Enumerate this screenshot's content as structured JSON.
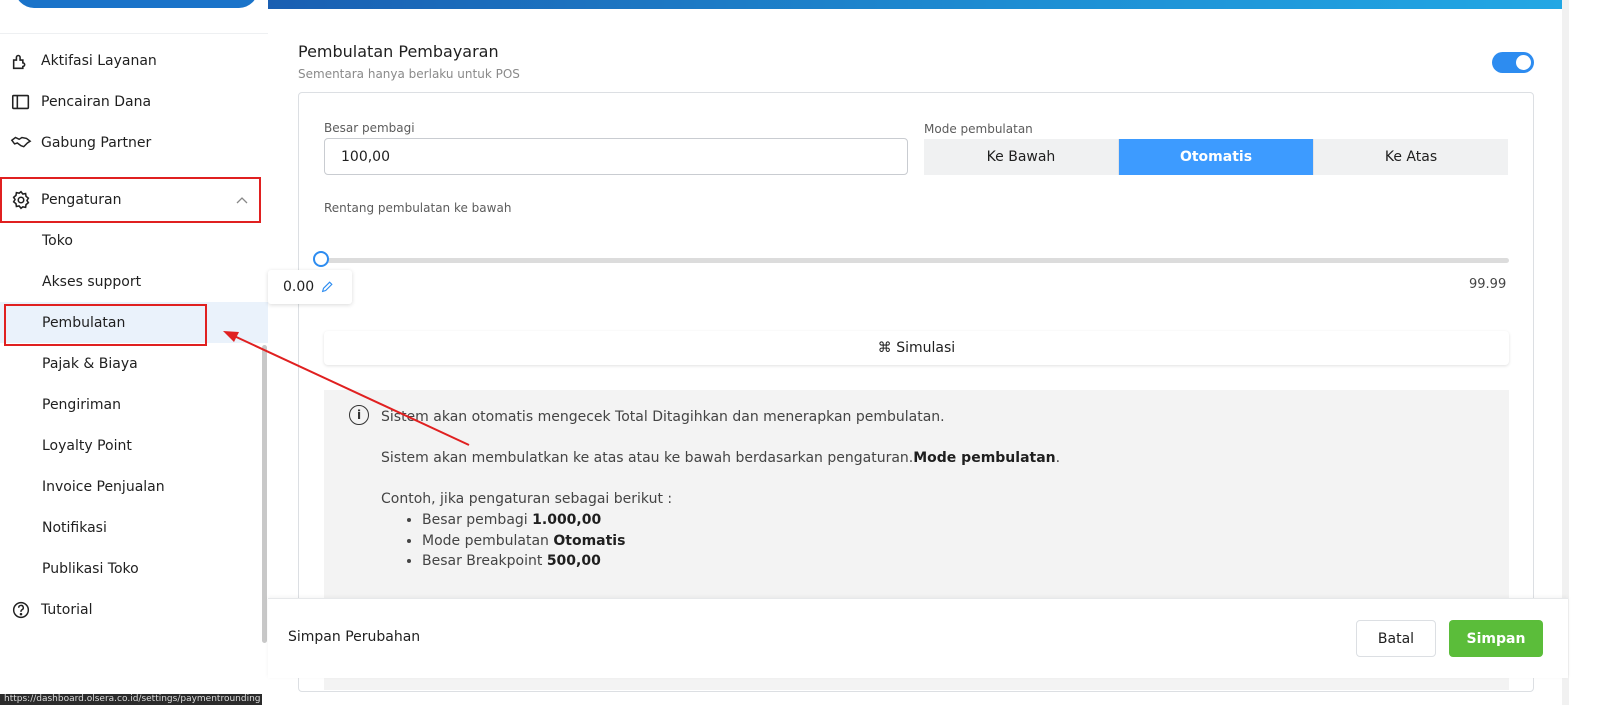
{
  "sidebar": {
    "items": [
      {
        "label": "Aktifasi Layanan",
        "icon": "puzzle-icon"
      },
      {
        "label": "Pencairan Dana",
        "icon": "wallet-icon"
      },
      {
        "label": "Gabung Partner",
        "icon": "handshake-icon"
      },
      {
        "label": "Pengaturan",
        "icon": "gear-icon"
      }
    ],
    "sub_items": [
      "Toko",
      "Akses support",
      "Pembulatan",
      "Pajak & Biaya",
      "Pengiriman",
      "Loyalty Point",
      "Invoice Penjualan",
      "Notifikasi",
      "Publikasi Toko"
    ],
    "tutorial": {
      "label": "Tutorial",
      "icon": "help-circle-icon"
    },
    "active_sub": "Pembulatan"
  },
  "statusbar": {
    "url": "https://dashboard.olsera.co.id/settings/paymentrounding"
  },
  "main": {
    "title": "Pembulatan Pembayaran",
    "subtitle": "Sementara hanya berlaku untuk POS",
    "toggle_on": true,
    "divider_label": "Besar pembagi",
    "divider_value": "100,00",
    "mode_label": "Mode pembulatan",
    "modes": [
      "Ke Bawah",
      "Otomatis",
      "Ke Atas"
    ],
    "selected_mode": "Otomatis",
    "range_label": "Rentang pembulatan ke bawah",
    "slider_value": "0.00",
    "slider_max": "99.99",
    "simulate_label": "⌘ Simulasi",
    "info": {
      "line1": "Sistem akan otomatis mengecek Total Ditagihkan dan menerapkan pembulatan.",
      "line2_prefix": "Sistem akan membulatkan ke atas atau ke bawah berdasarkan pengaturan.",
      "line2_bold": "Mode pembulatan",
      "line2_suffix": ".",
      "line3": "Contoh, jika pengaturan sebagai berikut :",
      "bullets": [
        {
          "text": "Besar pembagi ",
          "bold": "1.000,00"
        },
        {
          "text": "Mode pembulatan ",
          "bold": "Otomatis"
        },
        {
          "text": "Besar Breakpoint ",
          "bold": "500,00"
        }
      ]
    }
  },
  "footer": {
    "title": "Simpan Perubahan",
    "cancel_label": "Batal",
    "save_label": "Simpan"
  },
  "colors": {
    "accent": "#3d9bff",
    "save": "#5bbd3a",
    "highlight": "#e02020"
  }
}
